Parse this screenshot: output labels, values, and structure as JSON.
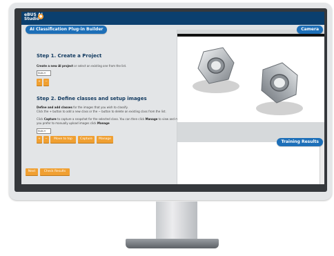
{
  "app": {
    "logo_line1": "eBUS AI",
    "logo_line2": "Studio"
  },
  "left_panel": {
    "title": "AI Classification Plug-in Builder",
    "step1": {
      "heading": "Step 1. Create a Project",
      "text_bold": "Create a new AI project",
      "text_rest": " or select an existing one from the list.",
      "select_value": "Nuts",
      "buttons": [
        "+",
        "−"
      ]
    },
    "step2": {
      "heading": "Step 2. Define classes and setup images",
      "text1_bold": "Define and add classes",
      "text1_rest": " for the images that you wish to classify.",
      "text2": "Click the + button to add a new class or the − button to delete an existing class from the list.",
      "text3_a": "Click ",
      "text3_b": "Capture",
      "text3_c": " to capture a snapshot for the selected class. You can then click ",
      "text3_d": "Manage",
      "text3_e": " to view and manage",
      "text4_a": "you prefer to manually upload images click ",
      "text4_b": "Manage",
      "select_value": "Nuts",
      "buttons": [
        "+",
        "−",
        "Move to top",
        "Capture",
        "Manage"
      ]
    },
    "footer_buttons": [
      "Next",
      "Check Results"
    ]
  },
  "right_panel": {
    "camera_label": "Camera",
    "results_label": "Training Results"
  },
  "colors": {
    "accent_blue": "#1d6fb8",
    "orange": "#f0a032",
    "topbar": "#0b3f6e"
  }
}
